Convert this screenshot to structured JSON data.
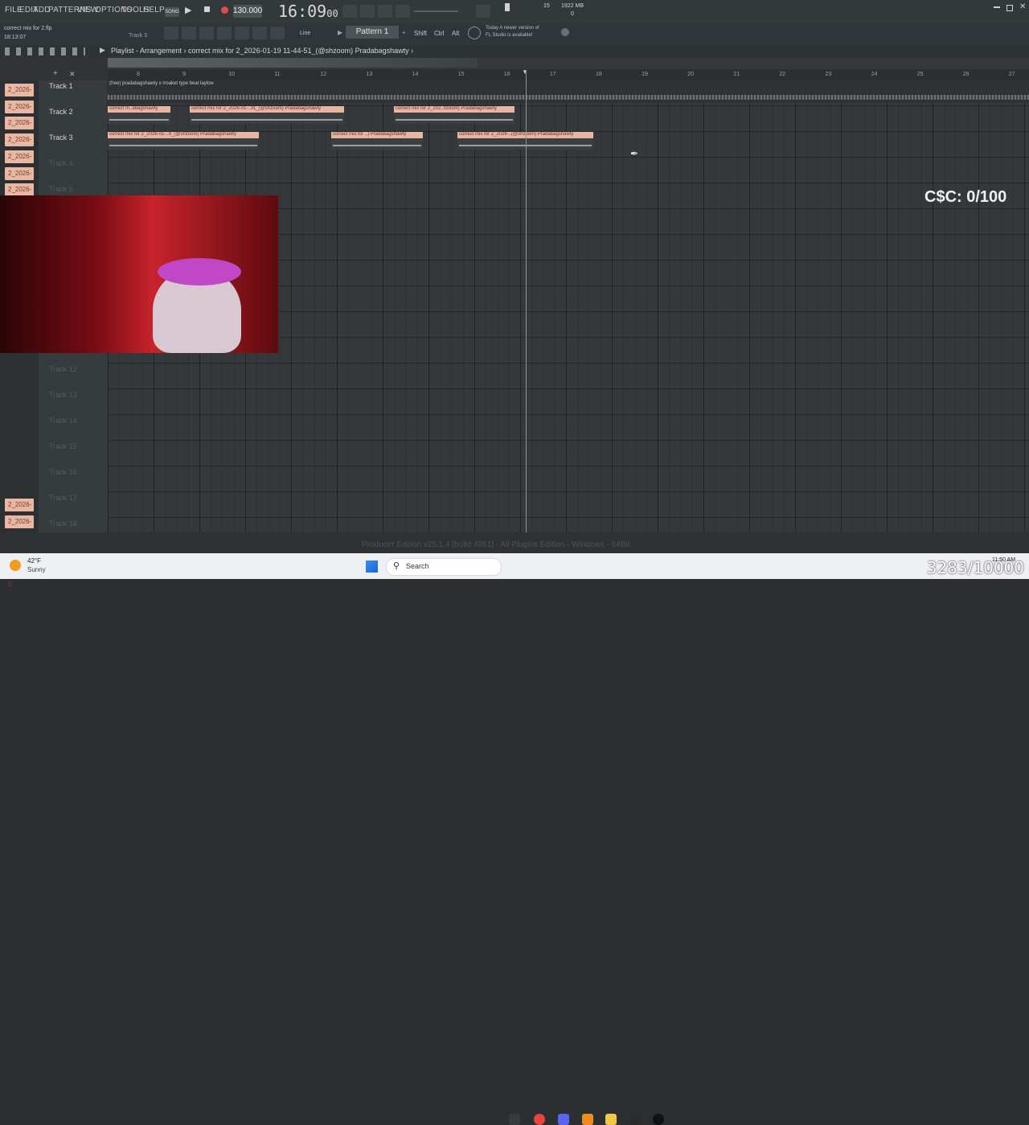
{
  "menu": [
    "FILE",
    "EDIT",
    "ADD",
    "PATTERNS",
    "VIEW",
    "OPTIONS",
    "TOOLS",
    "HELP"
  ],
  "song_mode": "SONG",
  "tempo": "130.000",
  "time": "16:09",
  "time_sub": "00",
  "memory": "1922 MB",
  "cpu": "15",
  "poly": "0",
  "hint": {
    "title": "correct mix for 2.flp",
    "time": "18:13:07",
    "track": "Track 3"
  },
  "snap": "Line",
  "pattern": "Pattern 1",
  "keys": [
    "Shift",
    "Ctrl",
    "Alt"
  ],
  "news": {
    "line1": "Today  A newer version of",
    "line2": "FL Studio is available!"
  },
  "breadcrumb": "Playlist - Arrangement  ›  correct mix for 2_2026-01-19 11-44-51_(@shzoom) Pradabagshawty  ›",
  "ruler": [
    "8",
    "9",
    "10",
    "11",
    "12",
    "13",
    "14",
    "15",
    "16",
    "17",
    "18",
    "19",
    "20",
    "21",
    "22",
    "23",
    "24",
    "25",
    "26",
    "27"
  ],
  "pool": [
    "2_2026-0",
    "2_2026-0",
    "2_2026-0",
    "2_2026-0",
    "2_2026-0",
    "2_2026-0",
    "2_2026-0",
    "2_2026-0",
    "2_2026-0",
    "2_2026-0",
    "2_2026-0",
    "2_2026-0",
    "2_2026-0",
    "2_2026-0",
    "2_2026-0",
    "2_2026-0",
    "2_2026-0",
    "2_2026-0",
    "2_2026-0",
    "2_2026-0",
    "2_2026-0"
  ],
  "tracks": [
    "Track 1",
    "Track 2",
    "Track 3",
    "Track 4",
    "Track 5",
    "Track 12",
    "Track 13",
    "Track 14",
    "Track 15",
    "Track 16",
    "Track 17",
    "Track 18"
  ],
  "clips": {
    "t1": "(free) pradabagshawty x rroaket type beat laylow",
    "t2a": "correct m..abagshawty",
    "t2b": "correct mix for 2_2026-01-..31_(@shzoom) Pradabagshawty",
    "t2c": "correct mix for 2_202..hzoom) Pradabagshawty",
    "t3a": "correct mix for 2_2026-01-..9_(@shzoom) Pradabagshawty",
    "t3b": "correct mix for ..) Pradabagshawty",
    "t3c": "correct mix for 2_2026-..(@shzoom) Pradabagshawty"
  },
  "score": "C$C: 0/100",
  "status": "Producer Edition v25.1.4 [build 4951] - All Plugins Edition - Windows - 64Bit",
  "weather": {
    "temp": "42°F",
    "cond": "Sunny"
  },
  "taskbar_search": "Search",
  "clock": "11:50 AM",
  "counter": "3283/10000"
}
